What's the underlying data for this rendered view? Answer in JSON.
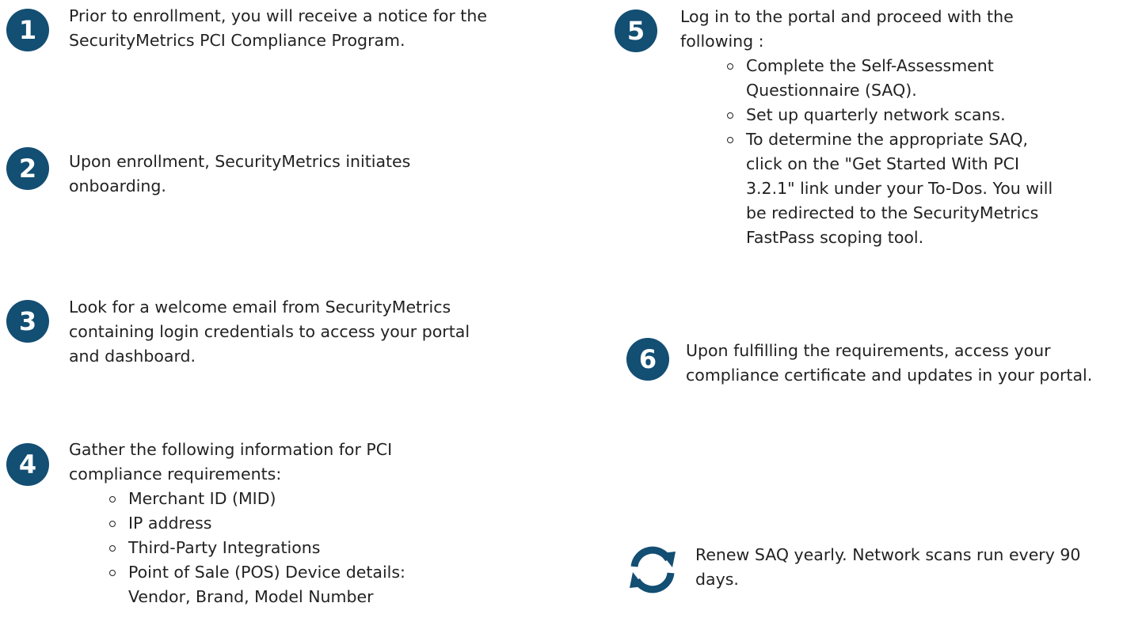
{
  "accent_color": "#134e73",
  "steps": [
    {
      "number": "1",
      "text": "Prior to enrollment, you will receive a notice for the SecurityMetrics PCI Compliance Program."
    },
    {
      "number": "2",
      "text": "Upon enrollment, SecurityMetrics initiates onboarding."
    },
    {
      "number": "3",
      "text": "Look for a welcome email from SecurityMetrics containing login credentials to access your portal and dashboard."
    },
    {
      "number": "4",
      "text": "Gather the following information for PCI compliance requirements:",
      "items": [
        "Merchant ID (MID)",
        "IP address",
        "Third-Party Integrations",
        "Point of Sale (POS) Device details: Vendor, Brand, Model Number"
      ]
    },
    {
      "number": "5",
      "text": "Log in to the portal and proceed with the following :",
      "items": [
        "Complete the Self-Assessment Questionnaire (SAQ).",
        "Set up quarterly network scans.",
        "To determine the appropriate SAQ, click on the \"Get Started With PCI 3.2.1\" link under your To-Dos. You will be redirected to the SecurityMetrics FastPass scoping tool."
      ]
    },
    {
      "number": "6",
      "text": "Upon fulfilling the requirements, access your compliance certificate and updates in your portal."
    }
  ],
  "renewal": {
    "icon": "refresh-icon",
    "text": "Renew SAQ yearly. Network scans run every 90 days."
  }
}
